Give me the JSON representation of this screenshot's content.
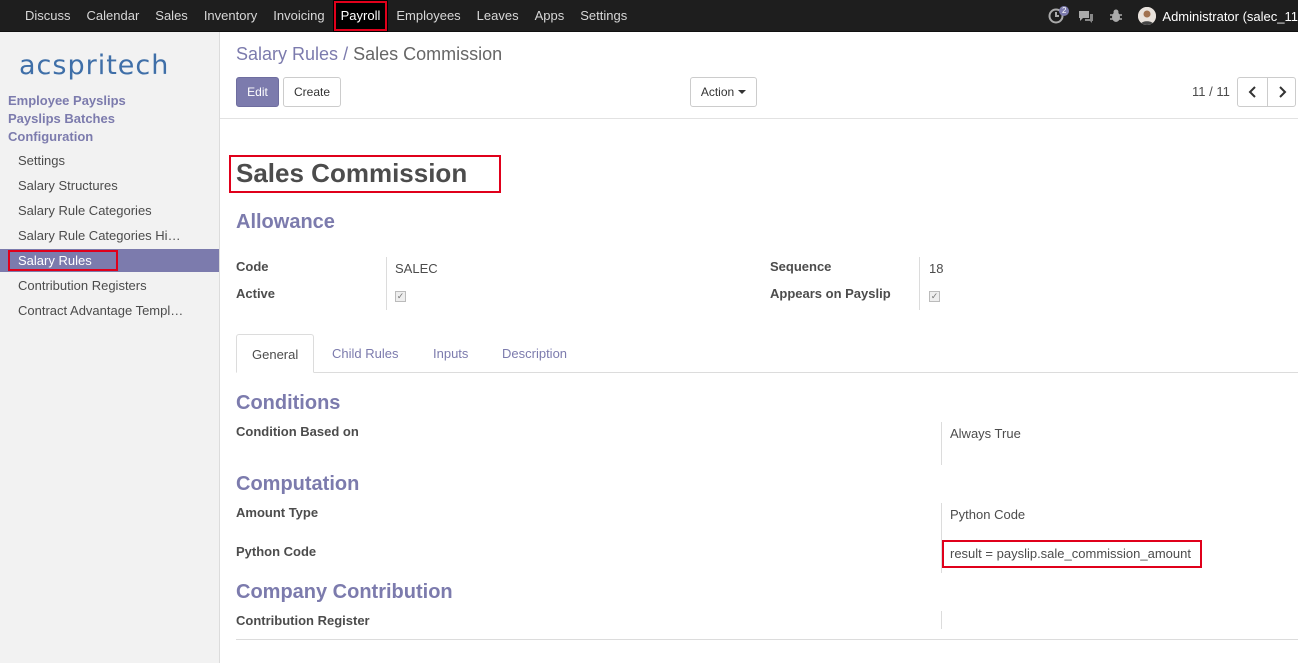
{
  "topbar": {
    "menu": [
      "Discuss",
      "Calendar",
      "Sales",
      "Inventory",
      "Invoicing",
      "Payroll",
      "Employees",
      "Leaves",
      "Apps",
      "Settings"
    ],
    "active_menu": "Payroll",
    "notification_count": "2",
    "user": "Administrator (salec_11"
  },
  "sidebar": {
    "logo": "acspritech",
    "sections": [
      "Employee Payslips",
      "Payslips Batches",
      "Configuration"
    ],
    "items": [
      "Settings",
      "Salary Structures",
      "Salary Rule Categories",
      "Salary Rule Categories Hi…",
      "Salary Rules",
      "Contribution Registers",
      "Contract Advantage Templ…"
    ],
    "active_item": "Salary Rules"
  },
  "control_panel": {
    "breadcrumb_parent": "Salary Rules",
    "breadcrumb_sep": "/",
    "breadcrumb_current": "Sales Commission",
    "edit_label": "Edit",
    "create_label": "Create",
    "action_label": "Action",
    "pager": "11 / 11"
  },
  "form": {
    "name": "Sales Commission",
    "category": "Allowance",
    "code_label": "Code",
    "code_value": "SALEC",
    "active_label": "Active",
    "active_checked": true,
    "sequence_label": "Sequence",
    "sequence_value": "18",
    "appears_label": "Appears on Payslip",
    "appears_checked": true,
    "tabs": [
      "General",
      "Child Rules",
      "Inputs",
      "Description"
    ],
    "active_tab": "General",
    "conditions_title": "Conditions",
    "condition_label": "Condition Based on",
    "condition_value": "Always True",
    "computation_title": "Computation",
    "amount_type_label": "Amount Type",
    "amount_type_value": "Python Code",
    "python_code_label": "Python Code",
    "python_code_value": "result = payslip.sale_commission_amount",
    "company_title": "Company Contribution",
    "register_label": "Contribution Register",
    "register_value": ""
  },
  "colors": {
    "brand": "#7c7bad",
    "topbar": "#1e1e1e",
    "highlight": "#e0001b"
  }
}
